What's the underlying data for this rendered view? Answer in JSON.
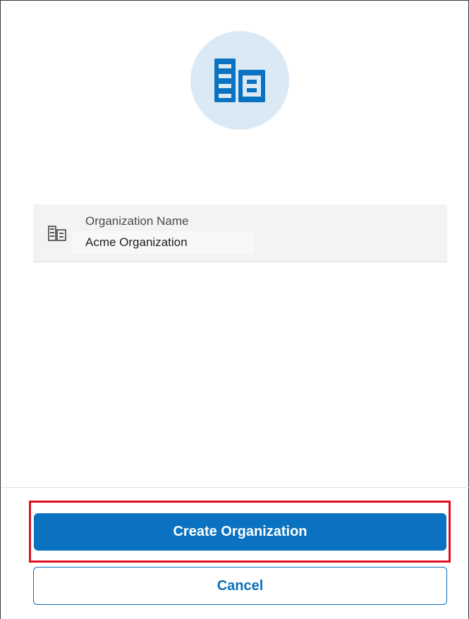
{
  "header": {
    "avatar_icon": "building-icon",
    "avatar_color": "#0a72c0",
    "avatar_bg": "#dbe9f5"
  },
  "form": {
    "organization_name": {
      "icon": "building-icon",
      "label": "Organization Name",
      "value": "Acme Organization"
    }
  },
  "actions": {
    "create_label": "Create Organization",
    "cancel_label": "Cancel",
    "primary_color": "#0a72c0",
    "highlight_color": "#e01020"
  }
}
